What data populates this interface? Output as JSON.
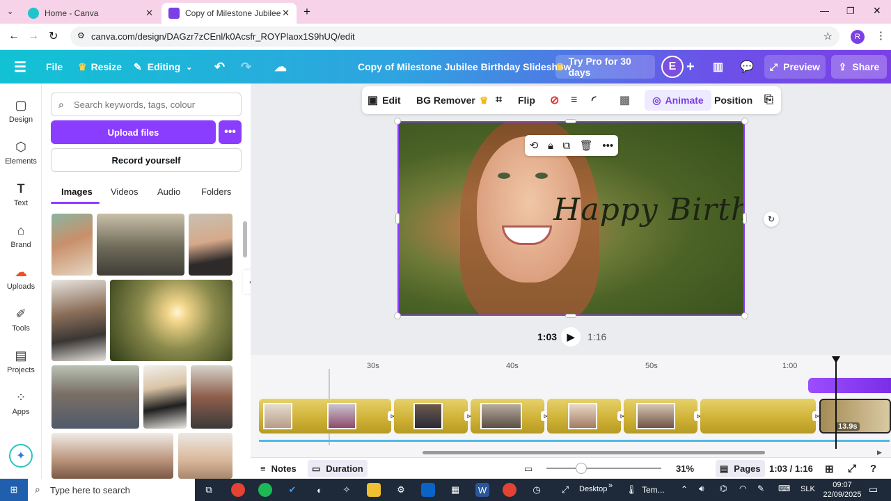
{
  "browser": {
    "tabs": [
      {
        "title": "Home - Canva",
        "icon": "canva-icon",
        "active": false
      },
      {
        "title": "Copy of Milestone Jubilee Birthd",
        "icon": "canva-video-icon",
        "active": true
      }
    ],
    "url": "canva.com/design/DAGzr7zCEnl/k0Acsfr_ROYPlaox1S9hUQ/edit",
    "profile_initial": "R"
  },
  "header": {
    "file_label": "File",
    "resize_label": "Resize",
    "editing_label": "Editing",
    "title": "Copy of Milestone Jubilee Birthday Slideshow",
    "pro_label": "Try Pro for 30 days",
    "user_initial": "E",
    "preview_label": "Preview",
    "share_label": "Share"
  },
  "rail": [
    {
      "label": "Design",
      "icon": "design-icon"
    },
    {
      "label": "Elements",
      "icon": "elements-icon"
    },
    {
      "label": "Text",
      "icon": "text-icon"
    },
    {
      "label": "Brand",
      "icon": "brand-icon"
    },
    {
      "label": "Uploads",
      "icon": "uploads-icon"
    },
    {
      "label": "Tools",
      "icon": "tools-icon"
    },
    {
      "label": "Projects",
      "icon": "projects-icon"
    },
    {
      "label": "Apps",
      "icon": "apps-icon"
    }
  ],
  "panel": {
    "search_placeholder": "Search keywords, tags, colour",
    "upload_label": "Upload files",
    "record_label": "Record yourself",
    "tabs": [
      "Images",
      "Videos",
      "Audio",
      "Folders"
    ],
    "active_tab": "Images"
  },
  "toolbar": {
    "edit": "Edit",
    "bg_remover": "BG Remover",
    "flip": "Flip",
    "animate": "Animate",
    "position": "Position"
  },
  "canvas": {
    "overlay_text": "Happy Birthday!"
  },
  "playback": {
    "current": "1:03",
    "total": "1:16"
  },
  "timeline": {
    "ticks": [
      "30s",
      "40s",
      "50s",
      "1:00"
    ],
    "last_clip_duration": "13.9s"
  },
  "footer": {
    "notes": "Notes",
    "duration": "Duration",
    "zoom": "31%",
    "pages": "Pages",
    "time": "1:03 / 1:16",
    "zoom_level": 0.31
  },
  "taskbar": {
    "search_placeholder": "Type here to search",
    "desktop_label": "Desktop",
    "tem_label": "Tem...",
    "slk_label": "SLK",
    "time": "09:07",
    "date": "22/09/2025"
  },
  "colors": {
    "accent": "#8b3dff",
    "header_start": "#12c2d4",
    "header_end": "#7b3fe6"
  }
}
